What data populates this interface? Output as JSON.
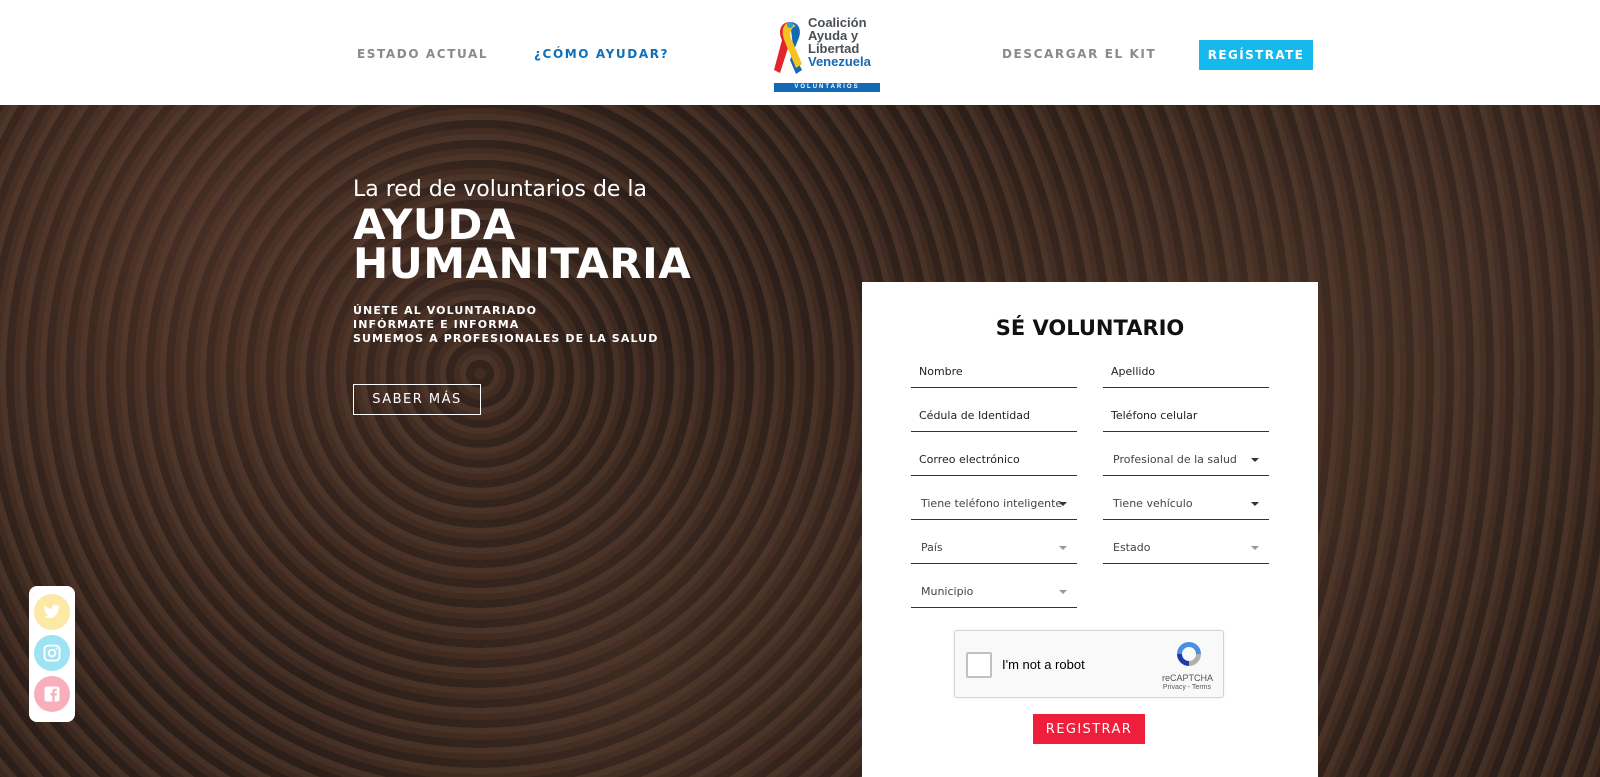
{
  "nav": {
    "estado": "ESTADO ACTUAL",
    "como_ayudar": "¿CÓMO AYUDAR?",
    "descargar": "DESCARGAR EL KIT",
    "registrate": "REGÍSTRATE"
  },
  "logo": {
    "line1": "Coalición",
    "line2": "Ayuda y",
    "line3": "Libertad",
    "line4": "Venezuela",
    "bar": "VOLUNTARIOS"
  },
  "hero": {
    "intro": "La red de voluntarios de la",
    "title_line1": "AYUDA",
    "title_line2": "HUMANITARIA",
    "bullets": [
      "ÚNETE AL VOLUNTARIADO",
      "INFÓRMATE E INFORMA",
      "SUMEMOS A PROFESIONALES DE LA SALUD"
    ],
    "cta": "SABER MÁS"
  },
  "social": {
    "icons": [
      "twitter-icon",
      "instagram-icon",
      "facebook-icon"
    ],
    "colors": {
      "twitter": "#fde9a6",
      "instagram": "#9ee3f4",
      "facebook": "#f9aebb"
    }
  },
  "form": {
    "title": "SÉ VOLUNTARIO",
    "nombre": "Nombre",
    "apellido": "Apellido",
    "cedula": "Cédula de Identidad",
    "telefono": "Teléfono celular",
    "correo": "Correo electrónico",
    "profesional": "Profesional de la salud",
    "smartphone": "Tiene teléfono inteligente",
    "vehiculo": "Tiene vehículo",
    "pais": "País",
    "estado": "Estado",
    "municipio": "Municipio",
    "submit": "REGISTRAR"
  },
  "captcha": {
    "label": "I'm not a robot",
    "brand": "reCAPTCHA",
    "terms": "Privacy - Terms"
  },
  "colors": {
    "accent_blue": "#16b9ec",
    "nav_active": "#0f6fb8",
    "submit_red": "#ef1e3b"
  }
}
